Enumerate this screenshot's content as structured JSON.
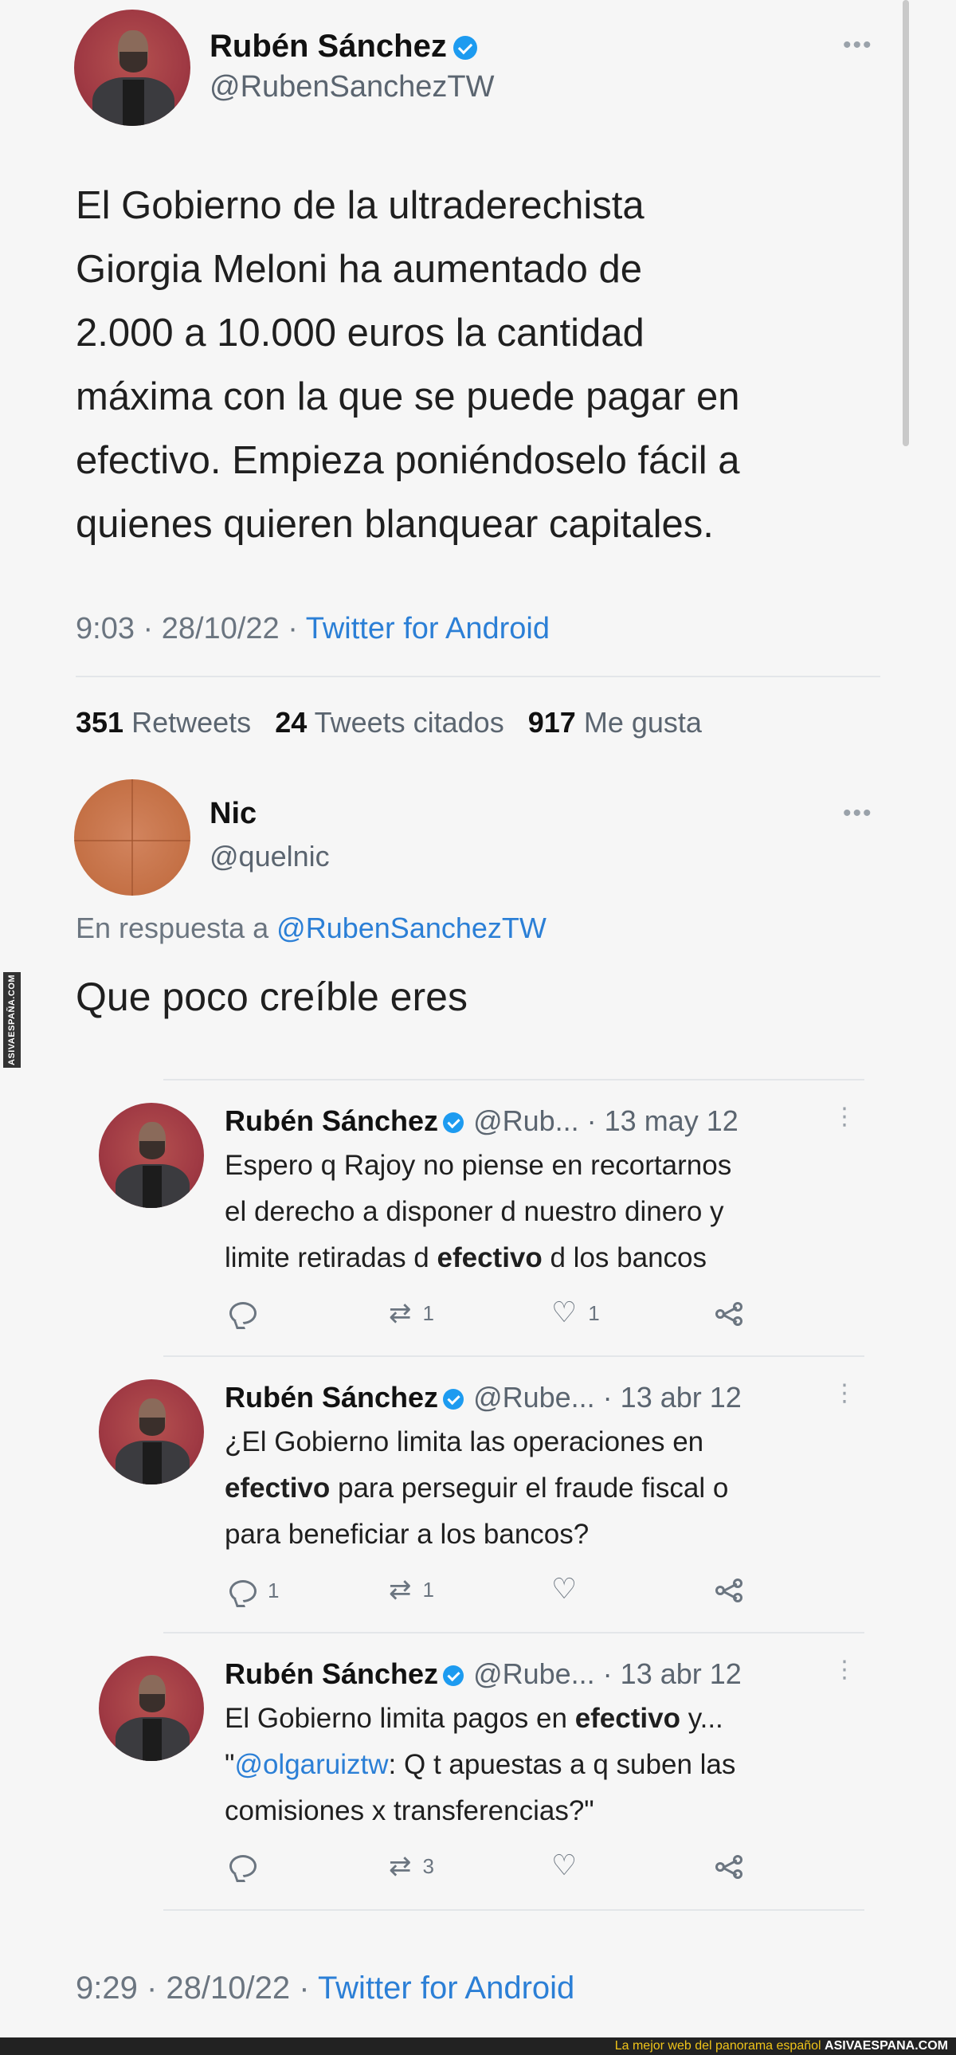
{
  "main_tweet": {
    "author_name": "Rubén Sánchez",
    "author_handle": "@RubenSanchezTW",
    "more_label": "•••",
    "text_lines": [
      "El Gobierno de la ultraderechista",
      "Giorgia Meloni ha aumentado de",
      "2.000 a 10.000 euros la cantidad",
      "máxima con la que se puede pagar en",
      "efectivo. Empieza poniéndoselo fácil a",
      "quienes quieren blanquear capitales."
    ],
    "time": "9:03 · 28/10/22 · ",
    "source": "Twitter for Android",
    "stats": {
      "retweets_count": "351",
      "retweets_label": "Retweets",
      "quotes_count": "24",
      "quotes_label": "Tweets citados",
      "likes_count": "917",
      "likes_label": "Me gusta"
    }
  },
  "reply": {
    "author_name": "Nic",
    "author_handle": "@quelnic",
    "more_label": "•••",
    "reply_prefix": "En respuesta a ",
    "reply_to": "@RubenSanchezTW",
    "text": "Que poco creíble eres"
  },
  "quoted_tweets": [
    {
      "name": "Rubén Sánchez",
      "handle_date": "@Rub... · 13 may 12",
      "text_html_parts": [
        [
          "Espero q Rajoy no piense en recortarnos"
        ],
        [
          "el derecho a disponer d nuestro dinero y"
        ],
        [
          "limite retiradas d ",
          "efectivo",
          " d los bancos"
        ]
      ],
      "replies": "",
      "retweets": "1",
      "likes": "1"
    },
    {
      "name": "Rubén Sánchez",
      "handle_date": "@Rube... · 13 abr 12",
      "text_html_parts": [
        [
          "¿El Gobierno limita las operaciones en"
        ],
        [
          "",
          "efectivo",
          " para perseguir el fraude fiscal o"
        ],
        [
          "para beneficiar a los bancos?"
        ]
      ],
      "replies": "1",
      "retweets": "1",
      "likes": ""
    },
    {
      "name": "Rubén Sánchez",
      "handle_date": "@Rube... · 13 abr 12",
      "text_html_parts": [
        [
          "El Gobierno limita pagos en ",
          "efectivo",
          " y..."
        ],
        [
          "\"",
          "@olgaruiztw",
          ": Q t apuestas a q suben las"
        ],
        [
          "comisiones x transferencias?\""
        ]
      ],
      "replies": "",
      "retweets": "3",
      "likes": ""
    }
  ],
  "reply_footer": {
    "time": "9:29 · 28/10/22 · ",
    "source": "Twitter for Android"
  },
  "watermark": {
    "side_text": "ASIVAESPAÑA.COM",
    "bottom_text": "La mejor web del panorama español ",
    "bottom_brand": "ASIVAESPANA.COM"
  },
  "colors": {
    "link": "#2b7fd6",
    "verified": "#1d9bf0",
    "muted": "#6b7580"
  }
}
